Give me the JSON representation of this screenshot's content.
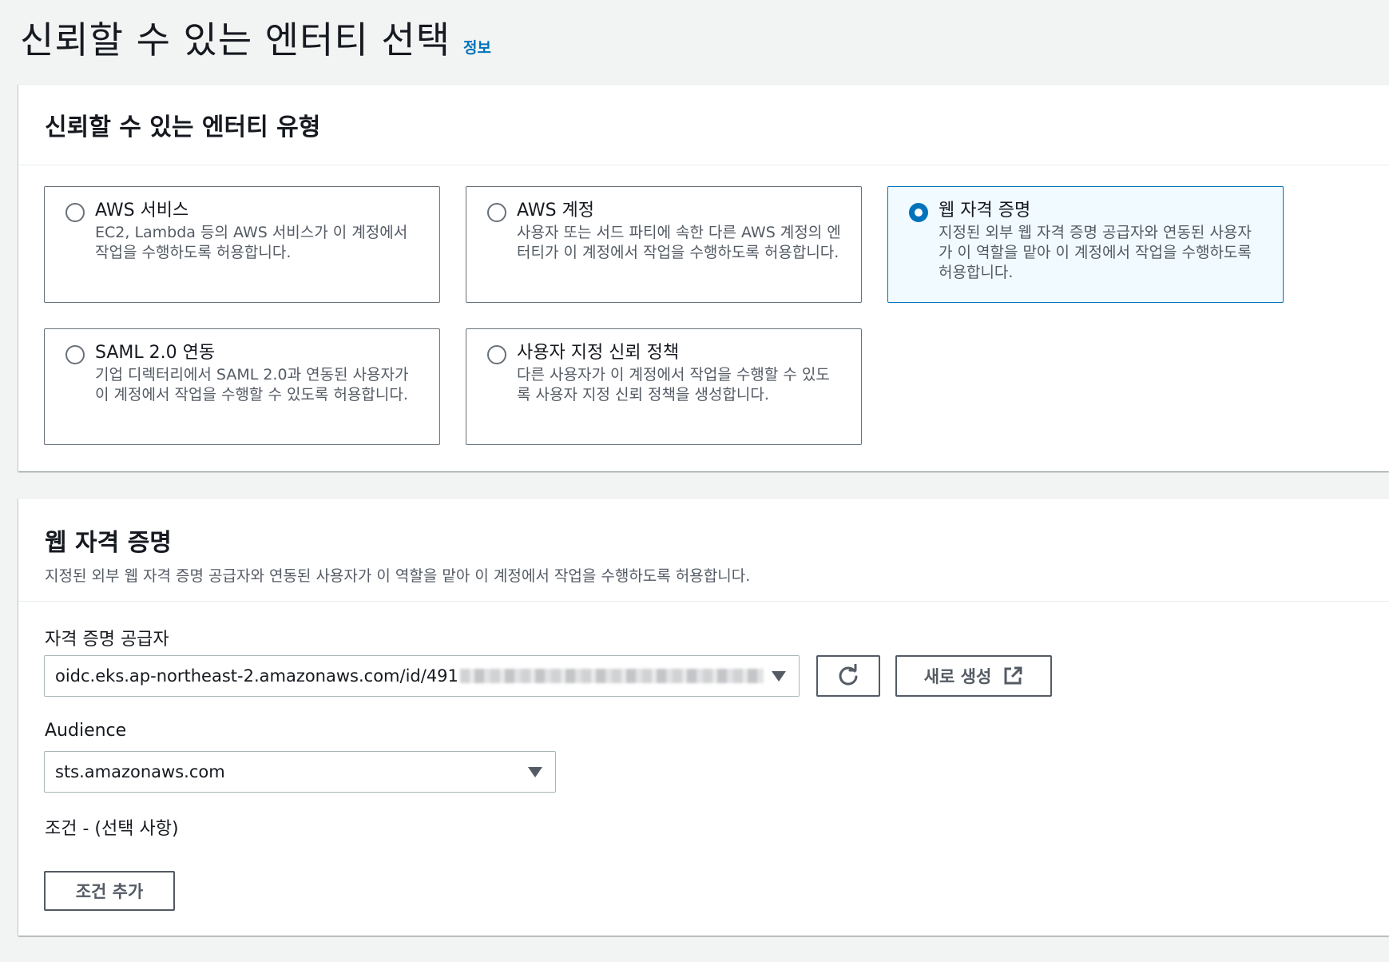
{
  "header": {
    "title": "신뢰할 수 있는 엔터티 선택",
    "info_link": "정보"
  },
  "entity_type_panel": {
    "title": "신뢰할 수 있는 엔터티 유형",
    "tiles": [
      {
        "title": "AWS 서비스",
        "description": "EC2, Lambda 등의 AWS 서비스가 이 계정에서 작업을 수행하도록 허용합니다.",
        "selected": false
      },
      {
        "title": "AWS 계정",
        "description": "사용자 또는 서드 파티에 속한 다른 AWS 계정의 엔터티가 이 계정에서 작업을 수행하도록 허용합니다.",
        "selected": false
      },
      {
        "title": "웹 자격 증명",
        "description": "지정된 외부 웹 자격 증명 공급자와 연동된 사용자가 이 역할을 맡아 이 계정에서 작업을 수행하도록 허용합니다.",
        "selected": true
      },
      {
        "title": "SAML 2.0 연동",
        "description": "기업 디렉터리에서 SAML 2.0과 연동된 사용자가 이 계정에서 작업을 수행할 수 있도록 허용합니다.",
        "selected": false
      },
      {
        "title": "사용자 지정 신뢰 정책",
        "description": "다른 사용자가 이 계정에서 작업을 수행할 수 있도록 사용자 지정 신뢰 정책을 생성합니다.",
        "selected": false
      }
    ]
  },
  "web_identity_panel": {
    "title": "웹 자격 증명",
    "description": "지정된 외부 웹 자격 증명 공급자와 연동된 사용자가 이 역할을 맡아 이 계정에서 작업을 수행하도록 허용합니다.",
    "provider_label": "자격 증명 공급자",
    "provider_value": "oidc.eks.ap-northeast-2.amazonaws.com/id/491",
    "refresh_icon": "refresh-icon",
    "create_new_label": "새로 생성",
    "external_link_icon": "external-link-icon",
    "audience_label": "Audience",
    "audience_value": "sts.amazonaws.com",
    "conditions_label": "조건 - (선택 사항)",
    "add_condition_label": "조건 추가"
  },
  "colors": {
    "accent": "#0073bb",
    "selected_tile_bg": "#f1faff",
    "page_bg": "#f2f3f3"
  }
}
